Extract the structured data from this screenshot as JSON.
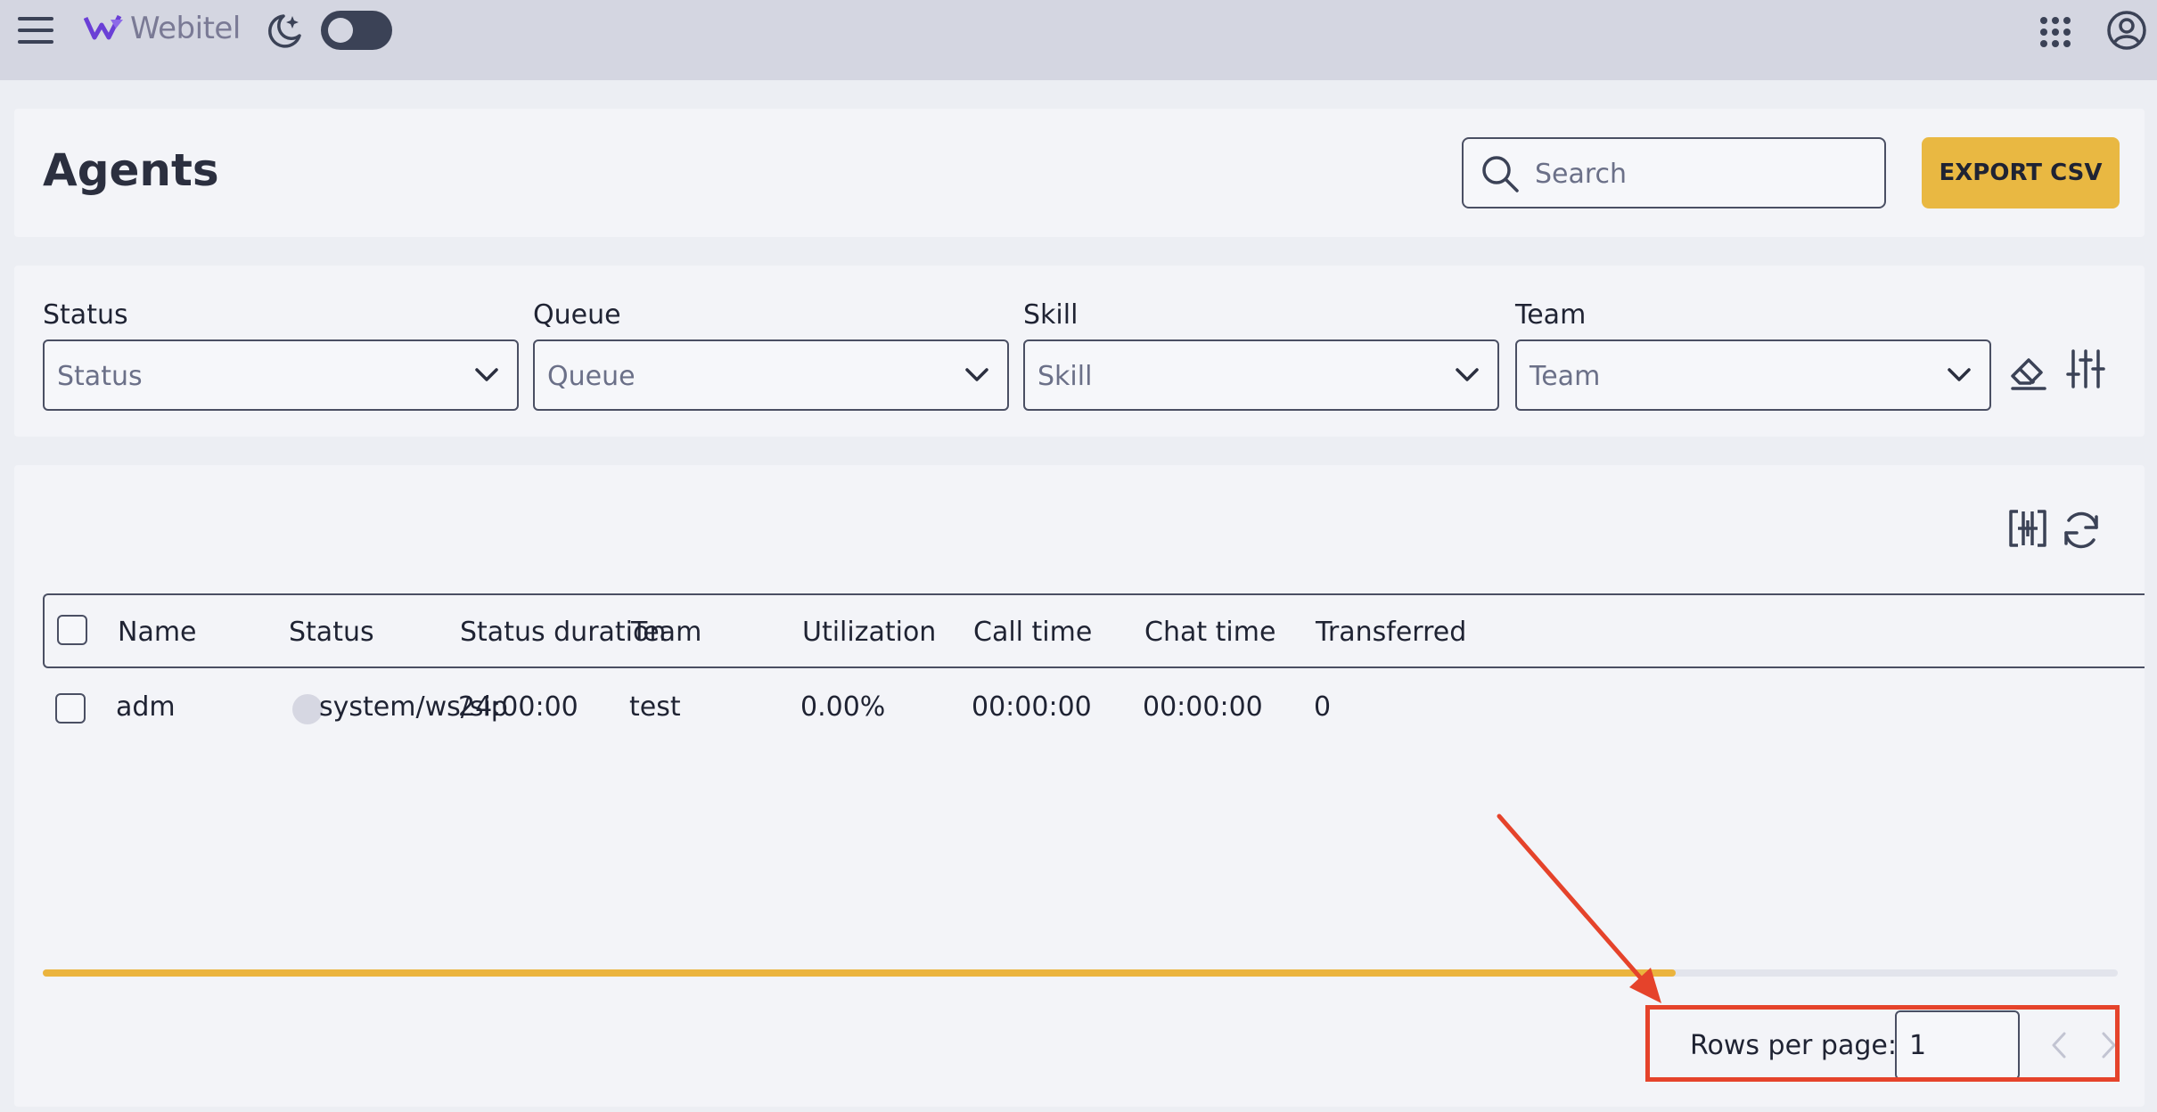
{
  "topbar": {
    "logo_text": "Webitel",
    "icons": [
      "menu-icon",
      "moon-stars-icon",
      "apps-grid-icon",
      "account-icon"
    ],
    "theme_toggle_on": false
  },
  "header": {
    "title": "Agents",
    "search_placeholder": "Search",
    "export_label": "EXPORT CSV"
  },
  "filters": [
    {
      "label": "Status",
      "placeholder": "Status"
    },
    {
      "label": "Queue",
      "placeholder": "Queue"
    },
    {
      "label": "Skill",
      "placeholder": "Skill"
    },
    {
      "label": "Team",
      "placeholder": "Team"
    }
  ],
  "table": {
    "columns": [
      "Name",
      "Status",
      "Status duration",
      "Team",
      "Utilization",
      "Call time",
      "Chat time",
      "Transferred"
    ],
    "rows": [
      {
        "name": "adm",
        "status": "system/ws/sip",
        "status_duration": "24:00:00",
        "team": "test",
        "utilization": "0.00%",
        "call_time": "00:00:00",
        "chat_time": "00:00:00",
        "transferred": "0"
      }
    ]
  },
  "pagination": {
    "rows_per_page_label": "Rows per page:",
    "rows_per_page_value": "1"
  },
  "colors": {
    "accent": "#e9b842",
    "annotation": "#e5432b",
    "topbar": "#d4d6e1",
    "border": "#4a4f63"
  }
}
